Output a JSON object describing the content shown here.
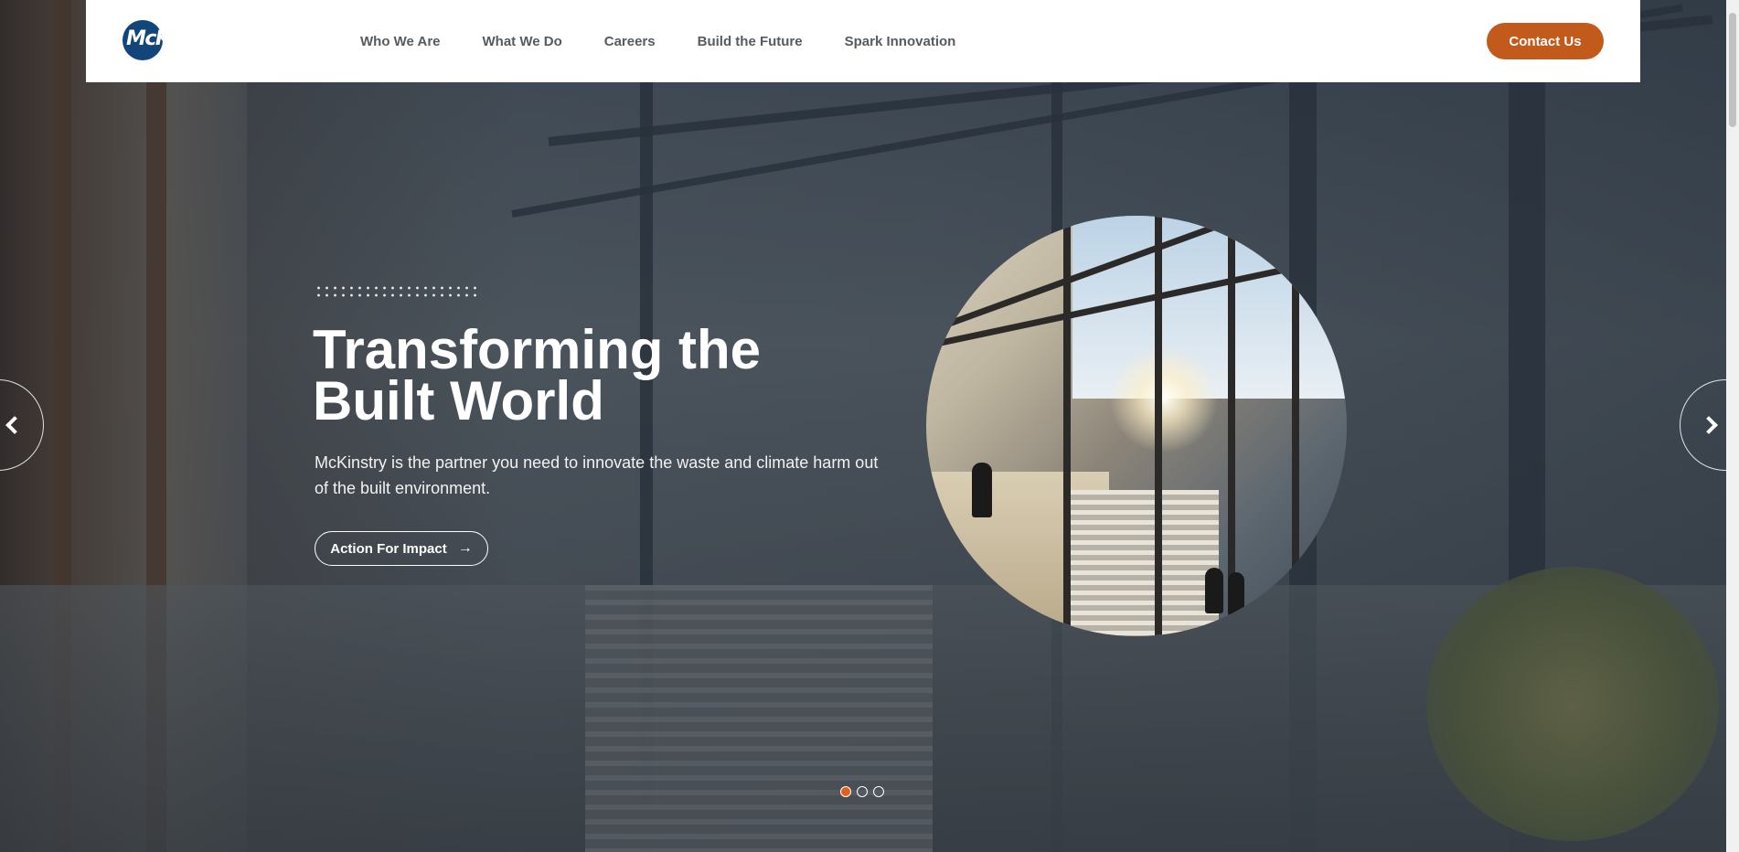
{
  "header": {
    "logo_text": "McKinstry",
    "nav": [
      {
        "label": "Who We Are"
      },
      {
        "label": "What We Do"
      },
      {
        "label": "Careers"
      },
      {
        "label": "Build the Future"
      },
      {
        "label": "Spark Innovation"
      }
    ],
    "contact_label": "Contact Us"
  },
  "hero": {
    "headline": "Transforming the Built World",
    "subtext": "McKinstry is the partner you need to innovate the waste and climate harm out of the built environment.",
    "cta_label": "Action For Impact",
    "cta_icon": "arrow-right-icon"
  },
  "carousel": {
    "prev_icon": "chevron-left-icon",
    "next_icon": "chevron-right-icon",
    "slide_count": 3,
    "active_slide": 1
  },
  "colors": {
    "accent": "#c25a1c",
    "logo_blue": "#12457a",
    "nav_text": "#555b61"
  }
}
